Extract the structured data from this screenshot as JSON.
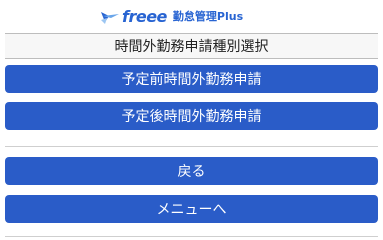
{
  "header": {
    "logo_text": "freee",
    "product_name": "勤怠管理Plus"
  },
  "page_title": "時間外勤務申請種別選択",
  "buttons": {
    "pre_request": "予定前時間外勤務申請",
    "post_request": "予定後時間外勤務申請",
    "back": "戻る",
    "menu": "メニューへ"
  },
  "colors": {
    "button_bg": "#2a5cc8",
    "logo_blue": "#2864d2"
  }
}
